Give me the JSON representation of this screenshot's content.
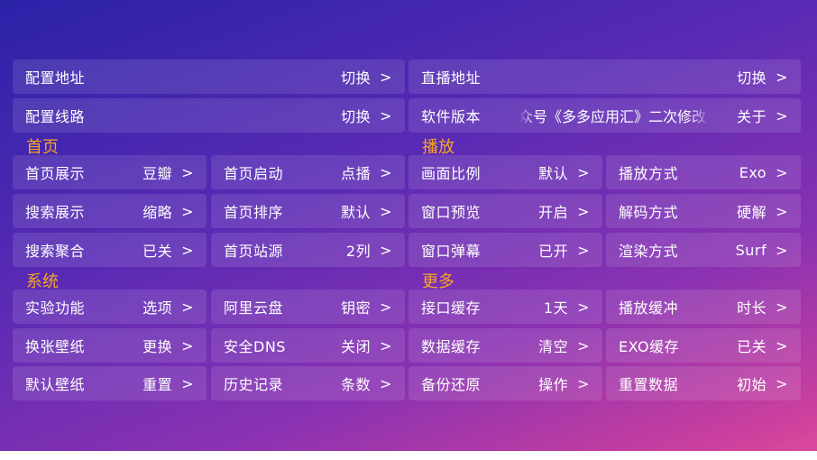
{
  "top": [
    {
      "label": "配置地址",
      "value": "切换",
      "arrow": ">"
    },
    {
      "label": "直播地址",
      "value": "切换",
      "arrow": ">"
    },
    {
      "label": "配置线路",
      "value": "切换",
      "arrow": ">"
    },
    {
      "label": "软件版本",
      "value": "关于",
      "arrow": ">",
      "marquee": "众号《多多应用汇》二次修改"
    }
  ],
  "sections": {
    "home": "首页",
    "play": "播放",
    "system": "系统",
    "more": "更多"
  },
  "home_items": [
    {
      "label": "首页展示",
      "value": "豆瓣",
      "arrow": ">"
    },
    {
      "label": "首页启动",
      "value": "点播",
      "arrow": ">"
    },
    {
      "label": "搜索展示",
      "value": "缩略",
      "arrow": ">"
    },
    {
      "label": "首页排序",
      "value": "默认",
      "arrow": ">"
    },
    {
      "label": "搜索聚合",
      "value": "已关",
      "arrow": ">"
    },
    {
      "label": "首页站源",
      "value": "2列",
      "arrow": ">"
    }
  ],
  "play_items": [
    {
      "label": "画面比例",
      "value": "默认",
      "arrow": ">"
    },
    {
      "label": "播放方式",
      "value": "Exo",
      "arrow": ">"
    },
    {
      "label": "窗口预览",
      "value": "开启",
      "arrow": ">"
    },
    {
      "label": "解码方式",
      "value": "硬解",
      "arrow": ">"
    },
    {
      "label": "窗口弹幕",
      "value": "已开",
      "arrow": ">"
    },
    {
      "label": "渲染方式",
      "value": "Surf",
      "arrow": ">"
    }
  ],
  "system_items": [
    {
      "label": "实验功能",
      "value": "选项",
      "arrow": ">"
    },
    {
      "label": "阿里云盘",
      "value": "钥密",
      "arrow": ">"
    },
    {
      "label": "换张壁纸",
      "value": "更换",
      "arrow": ">"
    },
    {
      "label": "安全DNS",
      "value": "关闭",
      "arrow": ">"
    },
    {
      "label": "默认壁纸",
      "value": "重置",
      "arrow": ">"
    },
    {
      "label": "历史记录",
      "value": "条数",
      "arrow": ">"
    }
  ],
  "more_items": [
    {
      "label": "接口缓存",
      "value": "1天",
      "arrow": ">"
    },
    {
      "label": "播放缓冲",
      "value": "时长",
      "arrow": ">"
    },
    {
      "label": "数据缓存",
      "value": "清空",
      "arrow": ">"
    },
    {
      "label": "EXO缓存",
      "value": "已关",
      "arrow": ">"
    },
    {
      "label": "备份还原",
      "value": "操作",
      "arrow": ">"
    },
    {
      "label": "重置数据",
      "value": "初始",
      "arrow": ">"
    }
  ],
  "colors": {
    "section_title": "#f5a623",
    "accent_start": "#2a22a8",
    "accent_end": "#dd4a9a"
  }
}
